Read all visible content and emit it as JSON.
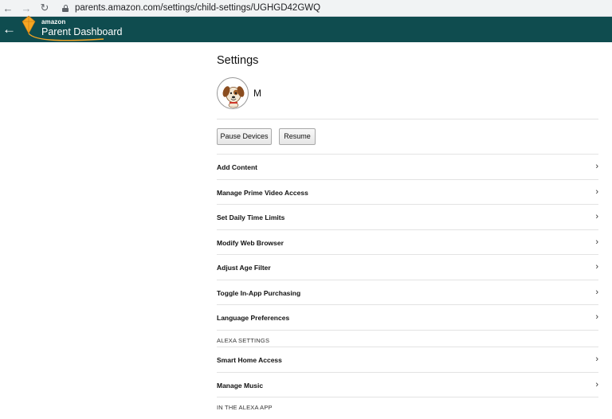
{
  "browser": {
    "back_icon": "arrow-left-icon",
    "forward_icon": "arrow-right-icon",
    "reload_icon": "reload-icon",
    "url": "parents.amazon.com/settings/child-settings/UGHGD42GWQ"
  },
  "header": {
    "brand_small": "amazon",
    "title": "Parent Dashboard",
    "background": "#0f4c4f"
  },
  "settings": {
    "title": "Settings",
    "child_name": "M",
    "pause_label": "Pause Devices",
    "resume_label": "Resume"
  },
  "menu": {
    "items": [
      {
        "label": "Add Content"
      },
      {
        "label": "Manage Prime Video Access"
      },
      {
        "label": "Set Daily Time Limits"
      },
      {
        "label": "Modify Web Browser"
      },
      {
        "label": "Adjust Age Filter"
      },
      {
        "label": "Toggle In-App Purchasing"
      },
      {
        "label": "Language Preferences"
      }
    ],
    "alexa_heading": "ALEXA SETTINGS",
    "alexa_items": [
      {
        "label": "Smart Home Access"
      },
      {
        "label": "Manage Music"
      }
    ],
    "alexa_app_heading": "IN THE ALEXA APP"
  }
}
